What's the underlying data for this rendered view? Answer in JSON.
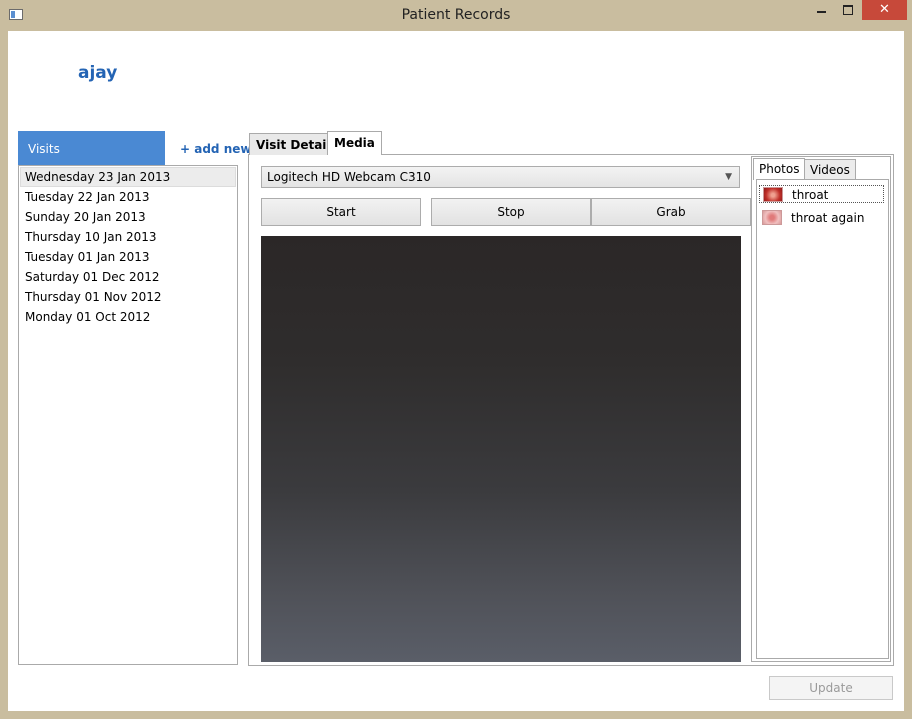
{
  "window": {
    "title": "Patient Records",
    "close_glyph": "✕"
  },
  "patient": {
    "name": "ajay"
  },
  "visits": {
    "header": "Visits",
    "add_new": "+ add new",
    "items": [
      "Wednesday 23 Jan 2013",
      "Tuesday 22 Jan 2013",
      "Sunday 20 Jan 2013",
      "Thursday 10 Jan 2013",
      "Tuesday 01 Jan 2013",
      "Saturday 01 Dec 2012",
      "Thursday 01 Nov 2012",
      "Monday 01 Oct 2012"
    ],
    "selected_index": 0
  },
  "tabs": {
    "visit_details": "Visit Details",
    "media": "Media",
    "active": "media"
  },
  "media": {
    "camera_selected": "Logitech HD Webcam C310",
    "start_label": "Start",
    "stop_label": "Stop",
    "grab_label": "Grab",
    "subtabs": {
      "photos": "Photos",
      "videos": "Videos",
      "active": "photos"
    },
    "photos": [
      {
        "label": "throat",
        "selected": true,
        "thumb": "throat-thumbnail-red"
      },
      {
        "label": "throat again",
        "selected": false,
        "thumb": "throat-thumbnail-pink"
      }
    ]
  },
  "footer": {
    "update_label": "Update",
    "update_enabled": false
  },
  "colors": {
    "accent": "#4a89d3",
    "link": "#2464b4",
    "close": "#c7493a"
  }
}
